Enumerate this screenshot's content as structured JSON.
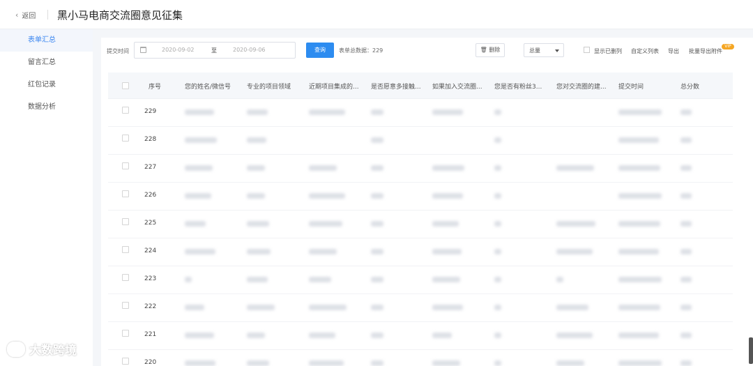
{
  "header": {
    "back_label": "返回",
    "title": "黑小马电商交流圈意见征集"
  },
  "sidebar": {
    "items": [
      {
        "label": "表单汇总",
        "active": true
      },
      {
        "label": "留言汇总",
        "active": false
      },
      {
        "label": "红包记录",
        "active": false
      },
      {
        "label": "数据分析",
        "active": false
      }
    ]
  },
  "toolbar": {
    "submit_time_label": "提交时间",
    "date_start": "2020-09-02",
    "date_separator": "至",
    "date_end": "2020-09-06",
    "query_label": "查询",
    "total_text": "表单总数据：229",
    "delete_label": "删除",
    "select_value": "总量",
    "show_deleted_label": "显示已删列",
    "custom_columns_label": "自定义列表",
    "export_label": "导出",
    "batch_export_label": "批量导出附件",
    "vip_badge": "VIP"
  },
  "table": {
    "columns": [
      "序号",
      "您的姓名/微信号",
      "专业的项目领域",
      "近期项目集成的...",
      "是否愿意多接触...",
      "如果加入交流圈...",
      "您是否有粉丝3...",
      "您对交流圈的建...",
      "提交时间",
      "总分数"
    ],
    "rows": [
      {
        "seq": "229"
      },
      {
        "seq": "228"
      },
      {
        "seq": "227"
      },
      {
        "seq": "226"
      },
      {
        "seq": "225"
      },
      {
        "seq": "224"
      },
      {
        "seq": "223"
      },
      {
        "seq": "222"
      },
      {
        "seq": "221"
      },
      {
        "seq": "220"
      }
    ]
  },
  "watermark": {
    "text": "大数跨境"
  },
  "colors": {
    "primary": "#2d8cf0",
    "sidebar_active_text": "#3a86f0",
    "vip": "#f5a623"
  }
}
